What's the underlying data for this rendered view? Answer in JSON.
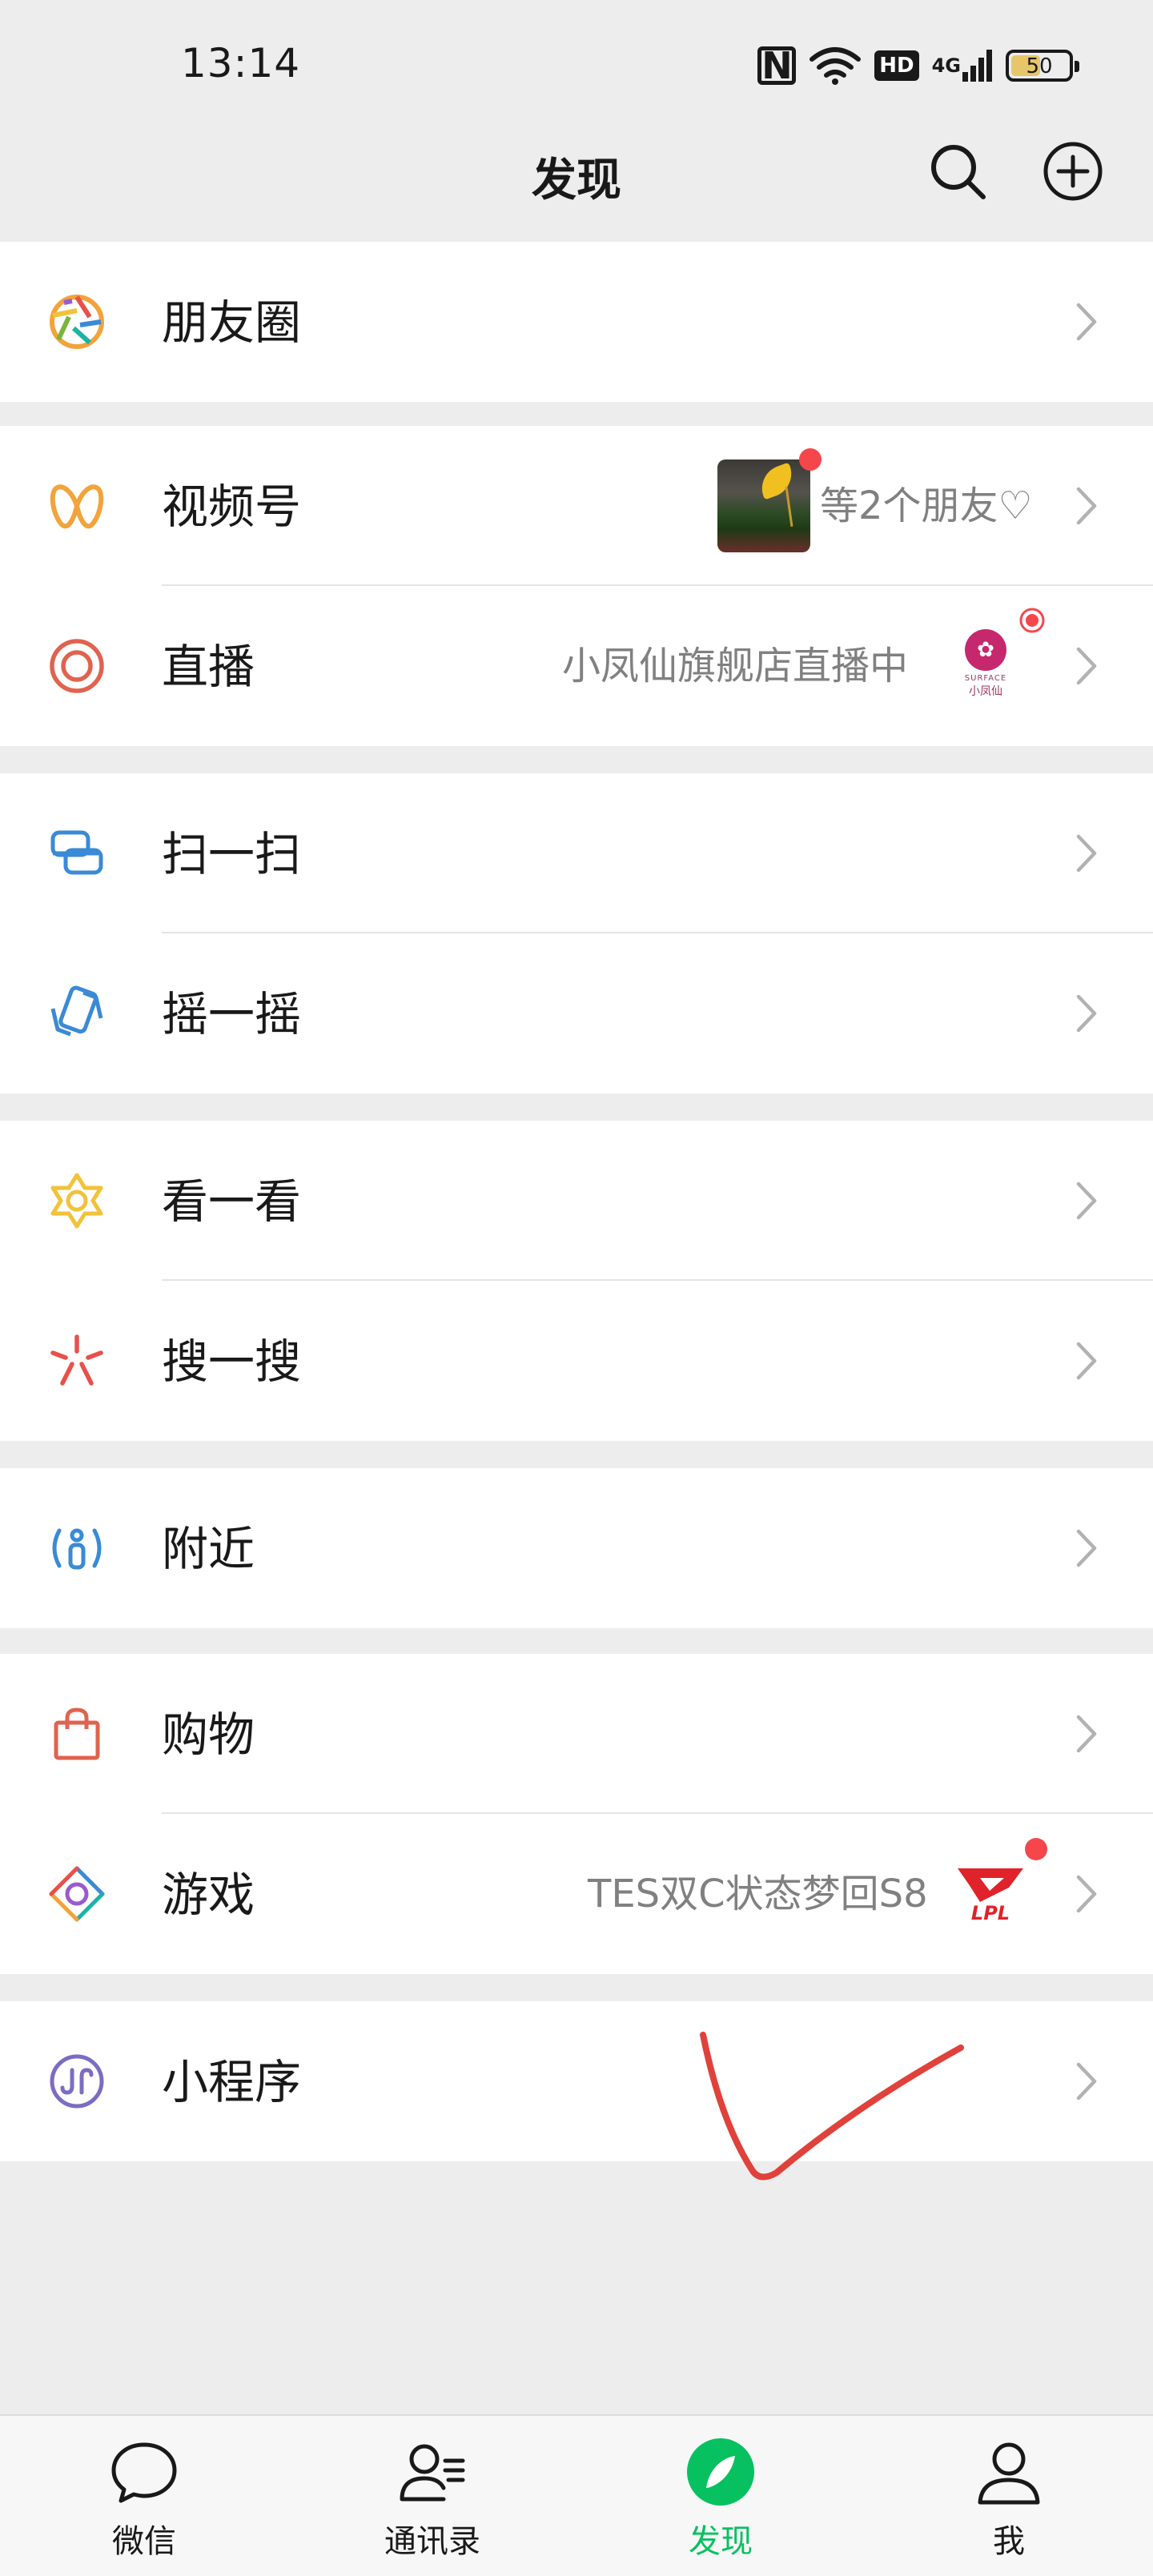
{
  "status_bar": {
    "time": "13:14",
    "nfc": "N",
    "hd": "HD",
    "network": "4G",
    "battery": "50"
  },
  "header": {
    "title": "发现",
    "search_icon": "search-icon",
    "add_icon": "plus-circle-icon"
  },
  "items": {
    "moments": {
      "label": "朋友圈",
      "icon": "moments-aperture-icon"
    },
    "channels": {
      "label": "视频号",
      "icon": "channels-icon",
      "right_text": "等2个朋友♡"
    },
    "live": {
      "label": "直播",
      "icon": "live-icon",
      "right_text": "小凤仙旗舰店直播中",
      "logo_text": "SURFACE",
      "logo_sub": "小凤仙"
    },
    "scan": {
      "label": "扫一扫",
      "icon": "scan-icon"
    },
    "shake": {
      "label": "摇一摇",
      "icon": "shake-icon"
    },
    "top_stories": {
      "label": "看一看",
      "icon": "top-stories-icon"
    },
    "search": {
      "label": "搜一搜",
      "icon": "search-star-icon"
    },
    "nearby": {
      "label": "附近",
      "icon": "nearby-icon"
    },
    "shopping": {
      "label": "购物",
      "icon": "shopping-bag-icon"
    },
    "games": {
      "label": "游戏",
      "icon": "games-icon",
      "right_text": "TES双C状态梦回S8",
      "logo_text": "LPL"
    },
    "mini_programs": {
      "label": "小程序",
      "icon": "mini-programs-icon"
    }
  },
  "tabbar": {
    "chats": "微信",
    "contacts": "通讯录",
    "discover": "发现",
    "me": "我"
  },
  "colors": {
    "accent": "#07c160",
    "background": "#ededed",
    "badge": "#f5474b",
    "annotation": "#e0413a"
  }
}
